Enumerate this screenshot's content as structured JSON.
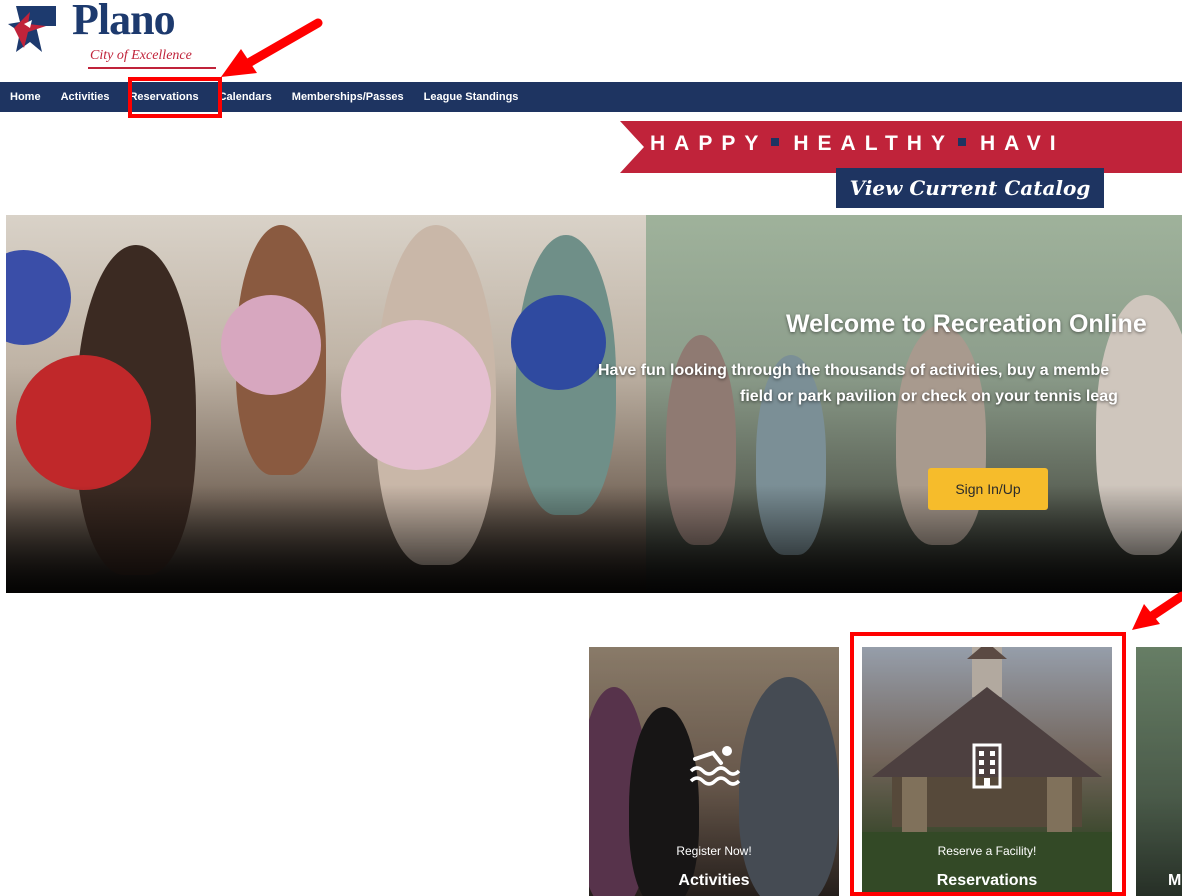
{
  "logo": {
    "brand": "Plano",
    "tagline": "City of Excellence"
  },
  "nav": {
    "items": [
      {
        "label": "Home"
      },
      {
        "label": "Activities"
      },
      {
        "label": "Reservations"
      },
      {
        "label": "Calendars"
      },
      {
        "label": "Memberships/Passes"
      },
      {
        "label": "League Standings"
      }
    ]
  },
  "banner": {
    "ribbon_words": [
      "HAPPY",
      "HEALTHY",
      "HAVI"
    ],
    "catalog_button": "View Current Catalog"
  },
  "hero": {
    "title": "Welcome to Recreation Online",
    "description_line1": "Have fun looking through the thousands of activities, buy a membe",
    "description_line2": "field or park pavilion or check on your tennis leag",
    "signin_button": "Sign In/Up"
  },
  "tiles": [
    {
      "label": "Register Now!",
      "title": "Activities",
      "icon": "swimmer-icon"
    },
    {
      "label": "Reserve a Facility!",
      "title": "Reservations",
      "icon": "building-icon"
    },
    {
      "label": "",
      "title": "M",
      "icon": ""
    }
  ],
  "colors": {
    "nav": "#1e3461",
    "ribbon": "#c0233a",
    "signin": "#f6bc2b",
    "annotation": "#ff0000"
  }
}
